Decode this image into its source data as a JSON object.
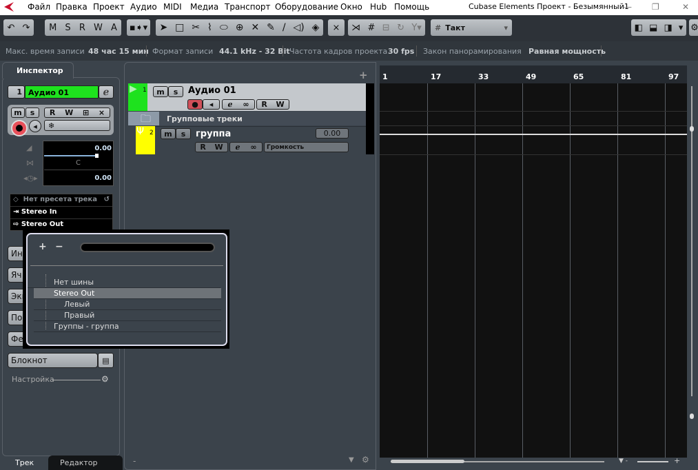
{
  "menu": {
    "items": [
      "Файл",
      "Правка",
      "Проект",
      "Аудио",
      "MIDI",
      "Медиа",
      "Транспорт",
      "Оборудование",
      "Окно",
      "Hub",
      "Помощь"
    ],
    "title": "Cubase Elements Проект - Безымянный1"
  },
  "toolbar": {
    "m": "M",
    "s": "S",
    "r": "R",
    "w": "W",
    "a": "A",
    "snap": "Такт"
  },
  "info": {
    "rec_time_label": "Макс. время записи",
    "rec_time": "48 час 15 мин",
    "format_label": "Формат записи",
    "format": "44.1 kHz - 32 Bit",
    "fps_label": "Частота кадров проекта",
    "fps": "30 fps",
    "pan_label": "Закон панорамирования",
    "pan": "Равная мощность"
  },
  "inspector": {
    "tab": "Инспектор",
    "track_num": "1",
    "track_name": "Аудио 01",
    "volume": "0.00",
    "pan": "C",
    "delay": "0.00",
    "preset": "Нет пресета трека",
    "input": "Stereo In",
    "output": "Stereo Out",
    "sections": [
      "Ин",
      "Яч",
      "Экв",
      "По",
      "Фе"
    ],
    "notepad": "Блокнот",
    "setup": "Настройка",
    "bottom_tabs": [
      "Трек",
      "Редактор"
    ]
  },
  "tracks": [
    {
      "num": "1",
      "name": "Аудио 01",
      "color": "#1ee21e"
    },
    {
      "name": "Групповые треки"
    },
    {
      "num": "2",
      "name": "группа",
      "value": "0.00",
      "automation": "Громкость",
      "color": "#ffff00"
    }
  ],
  "popup": {
    "plus": "+",
    "minus": "−",
    "items": [
      "Нет шины",
      "Stereo Out",
      "Левый",
      "Правый",
      "Группы - группа"
    ],
    "selected": "Stereo Out"
  },
  "ruler": [
    "1",
    "17",
    "33",
    "49",
    "65",
    "81",
    "97"
  ]
}
